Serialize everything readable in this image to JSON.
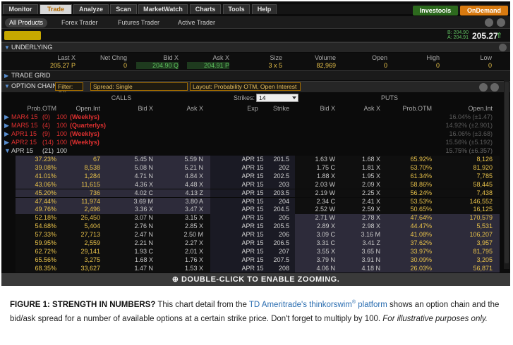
{
  "menu": {
    "tabs": [
      "Monitor",
      "Trade",
      "Analyze",
      "Scan",
      "MarketWatch",
      "Charts",
      "Tools",
      "Help"
    ],
    "active": "Trade",
    "investools": "Investools",
    "ondemand": "OnDemand"
  },
  "subtabs": [
    "All Products",
    "Forex Trader",
    "Futures Trader",
    "Active Trader"
  ],
  "quote": {
    "bid_small": "B: 204.90",
    "ask_small": "A: 204.91",
    "last": "205.27",
    "pct_arrow": "⇑"
  },
  "underlying": {
    "title": "UNDERLYING",
    "headers": [
      "Last X",
      "Net Chng",
      "Bid X",
      "Ask X",
      "Size",
      "Volume",
      "Open",
      "High",
      "Low"
    ],
    "values": [
      "205.27 P",
      "0",
      "204.90 Q",
      "204.91 P",
      "3 x 5",
      "82,969",
      "0",
      "0",
      "0"
    ]
  },
  "trade_grid": "TRADE GRID",
  "option_chain": {
    "title": "OPTION CHAIN",
    "filter": "Filter: Off",
    "spread": "Spread: Single",
    "layout": "Layout: Probability OTM, Open Interest",
    "strikes_label": "Strikes:",
    "strikes_value": "14"
  },
  "headers": {
    "calls": "CALLS",
    "puts": "PUTS",
    "cols": [
      "Prob.OTM",
      "Open.Int",
      "Bid X",
      "Ask X",
      "Exp",
      "Strike",
      "Bid X",
      "Ask X",
      "Prob.OTM",
      "Open.Int"
    ]
  },
  "expirations": [
    {
      "name": "MAR4 15",
      "count": "(0)",
      "mult": "100",
      "tag": "(Weeklys)",
      "iv": "16.04% (±1.47)"
    },
    {
      "name": "MAR5 15",
      "count": "(4)",
      "mult": "100",
      "tag": "(Quarterlys)",
      "iv": "14.92% (±2.901)"
    },
    {
      "name": "APR1 15",
      "count": "(9)",
      "mult": "100",
      "tag": "(Weeklys)",
      "iv": "16.06% (±3.68)"
    },
    {
      "name": "APR2 15",
      "count": "(14)",
      "mult": "100",
      "tag": "(Weeklys)",
      "iv": "15.56% (±5.192)"
    },
    {
      "name": "APR 15",
      "count": "(21)",
      "mult": "100",
      "tag": "",
      "iv": "15.75% (±6.357)"
    }
  ],
  "rows": [
    [
      "37.23%",
      "67",
      "5.45 N",
      "5.59 N",
      "APR 15",
      "201.5",
      "1.63 W",
      "1.68 X",
      "65.92%",
      "8,126"
    ],
    [
      "39.08%",
      "8,538",
      "5.08 N",
      "5.21 N",
      "APR 15",
      "202",
      "1.75 C",
      "1.81 X",
      "63.70%",
      "81,920"
    ],
    [
      "41.01%",
      "1,284",
      "4.71 N",
      "4.84 X",
      "APR 15",
      "202.5",
      "1.88 X",
      "1.95 X",
      "61.34%",
      "7,785"
    ],
    [
      "43.06%",
      "11,615",
      "4.36 X",
      "4.48 X",
      "APR 15",
      "203",
      "2.03 W",
      "2.09 X",
      "58.86%",
      "58,445"
    ],
    [
      "45.20%",
      "736",
      "4.02 C",
      "4.13 Z",
      "APR 15",
      "203.5",
      "2.19 W",
      "2.25 X",
      "56.24%",
      "7,438"
    ],
    [
      "47.44%",
      "11,974",
      "3.69 M",
      "3.80 A",
      "APR 15",
      "204",
      "2.34 C",
      "2.41 X",
      "53.53%",
      "146,552"
    ],
    [
      "49.76%",
      "2,496",
      "3.36 X",
      "3.47 X",
      "APR 15",
      "204.5",
      "2.52 W",
      "2.59 X",
      "50.65%",
      "16,125"
    ],
    [
      "52.18%",
      "26,450",
      "3.07 N",
      "3.15 X",
      "APR 15",
      "205",
      "2.71 W",
      "2.78 X",
      "47.64%",
      "170,579"
    ],
    [
      "54.68%",
      "5,404",
      "2.76 N",
      "2.85 X",
      "APR 15",
      "205.5",
      "2.89 X",
      "2.98 X",
      "44.47%",
      "5,531"
    ],
    [
      "57.33%",
      "27,713",
      "2.47 N",
      "2.50 M",
      "APR 15",
      "206",
      "3.09 C",
      "3.16 M",
      "41.08%",
      "106,207"
    ],
    [
      "59.95%",
      "2,559",
      "2.21 N",
      "2.27 X",
      "APR 15",
      "206.5",
      "3.31 C",
      "3.41 Z",
      "37.62%",
      "3,957"
    ],
    [
      "62.72%",
      "29,141",
      "1.93 C",
      "2.01 X",
      "APR 15",
      "207",
      "3.55 X",
      "3.65 N",
      "33.97%",
      "81,795"
    ],
    [
      "65.56%",
      "3,275",
      "1.68 X",
      "1.76 X",
      "APR 15",
      "207.5",
      "3.79 N",
      "3.91 N",
      "30.09%",
      "3,205"
    ],
    [
      "68.35%",
      "33,627",
      "1.47 N",
      "1.53 X",
      "APR 15",
      "208",
      "4.06 N",
      "4.18 N",
      "26.03%",
      "56,871"
    ]
  ],
  "zoom_text": "DOUBLE-CLICK TO ENABLE ZOOMING.",
  "caption": {
    "fig": "FIGURE 1: STRENGTH IN NUMBERS?",
    "t1": " This chart detail from the ",
    "link": "TD Ameritrade's thinkorswim",
    "sup": "®",
    "link2": " platform",
    "t2": " shows an option chain and the bid/ask spread for a number of available options at a certain strike price. Don't forget to multiply by 100. ",
    "ital": "For illustrative purposes only."
  },
  "colors": {
    "call_text": "#e8c24a",
    "put_text": "#e8c24a",
    "mid_text": "#d0d0d0",
    "red": "#e03030",
    "itm_bg": "#2d2b3a"
  }
}
